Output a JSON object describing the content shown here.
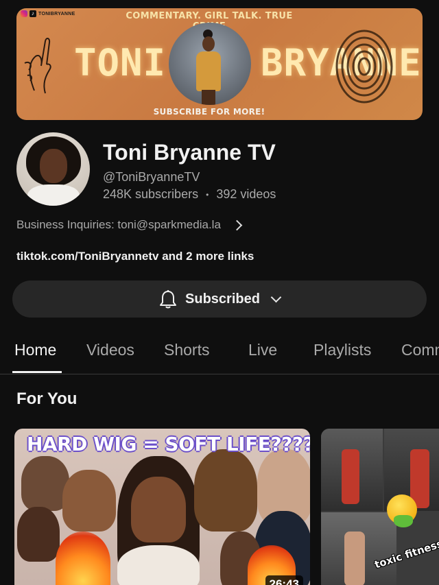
{
  "banner": {
    "social_handle": "TONIBRYANNE",
    "tagline": "COMMENTARY. GIRL TALK. TRUE CRIME",
    "name_left": "TONI",
    "name_right": "BRYANNE",
    "subscribe_text": "SUBSCRIBE FOR MORE!"
  },
  "channel": {
    "name": "Toni Bryanne TV",
    "handle": "@ToniBryanneTV",
    "subscribers": "248K subscribers",
    "separator": "•",
    "videos": "392 videos",
    "business": "Business Inquiries: toni@sparkmedia.la",
    "links": "tiktok.com/ToniBryannetv and 2 more links"
  },
  "subscribe_button": {
    "label": "Subscribed",
    "icon": "bell-icon"
  },
  "tabs": [
    {
      "label": "Home",
      "active": true
    },
    {
      "label": "Videos",
      "active": false
    },
    {
      "label": "Shorts",
      "active": false
    },
    {
      "label": "Live",
      "active": false
    },
    {
      "label": "Playlists",
      "active": false
    },
    {
      "label": "Comm",
      "active": false
    }
  ],
  "section": {
    "title": "For You"
  },
  "videos": [
    {
      "thumb_text": "HARD WIG = SOFT LIFE????",
      "duration": "26:43"
    },
    {
      "thumb_text": "toxic fitness"
    }
  ],
  "colors": {
    "background": "#0f0f0f",
    "button_bg": "#272727",
    "secondary_text": "#aaaaaa",
    "banner_orange": "#d4894f"
  }
}
